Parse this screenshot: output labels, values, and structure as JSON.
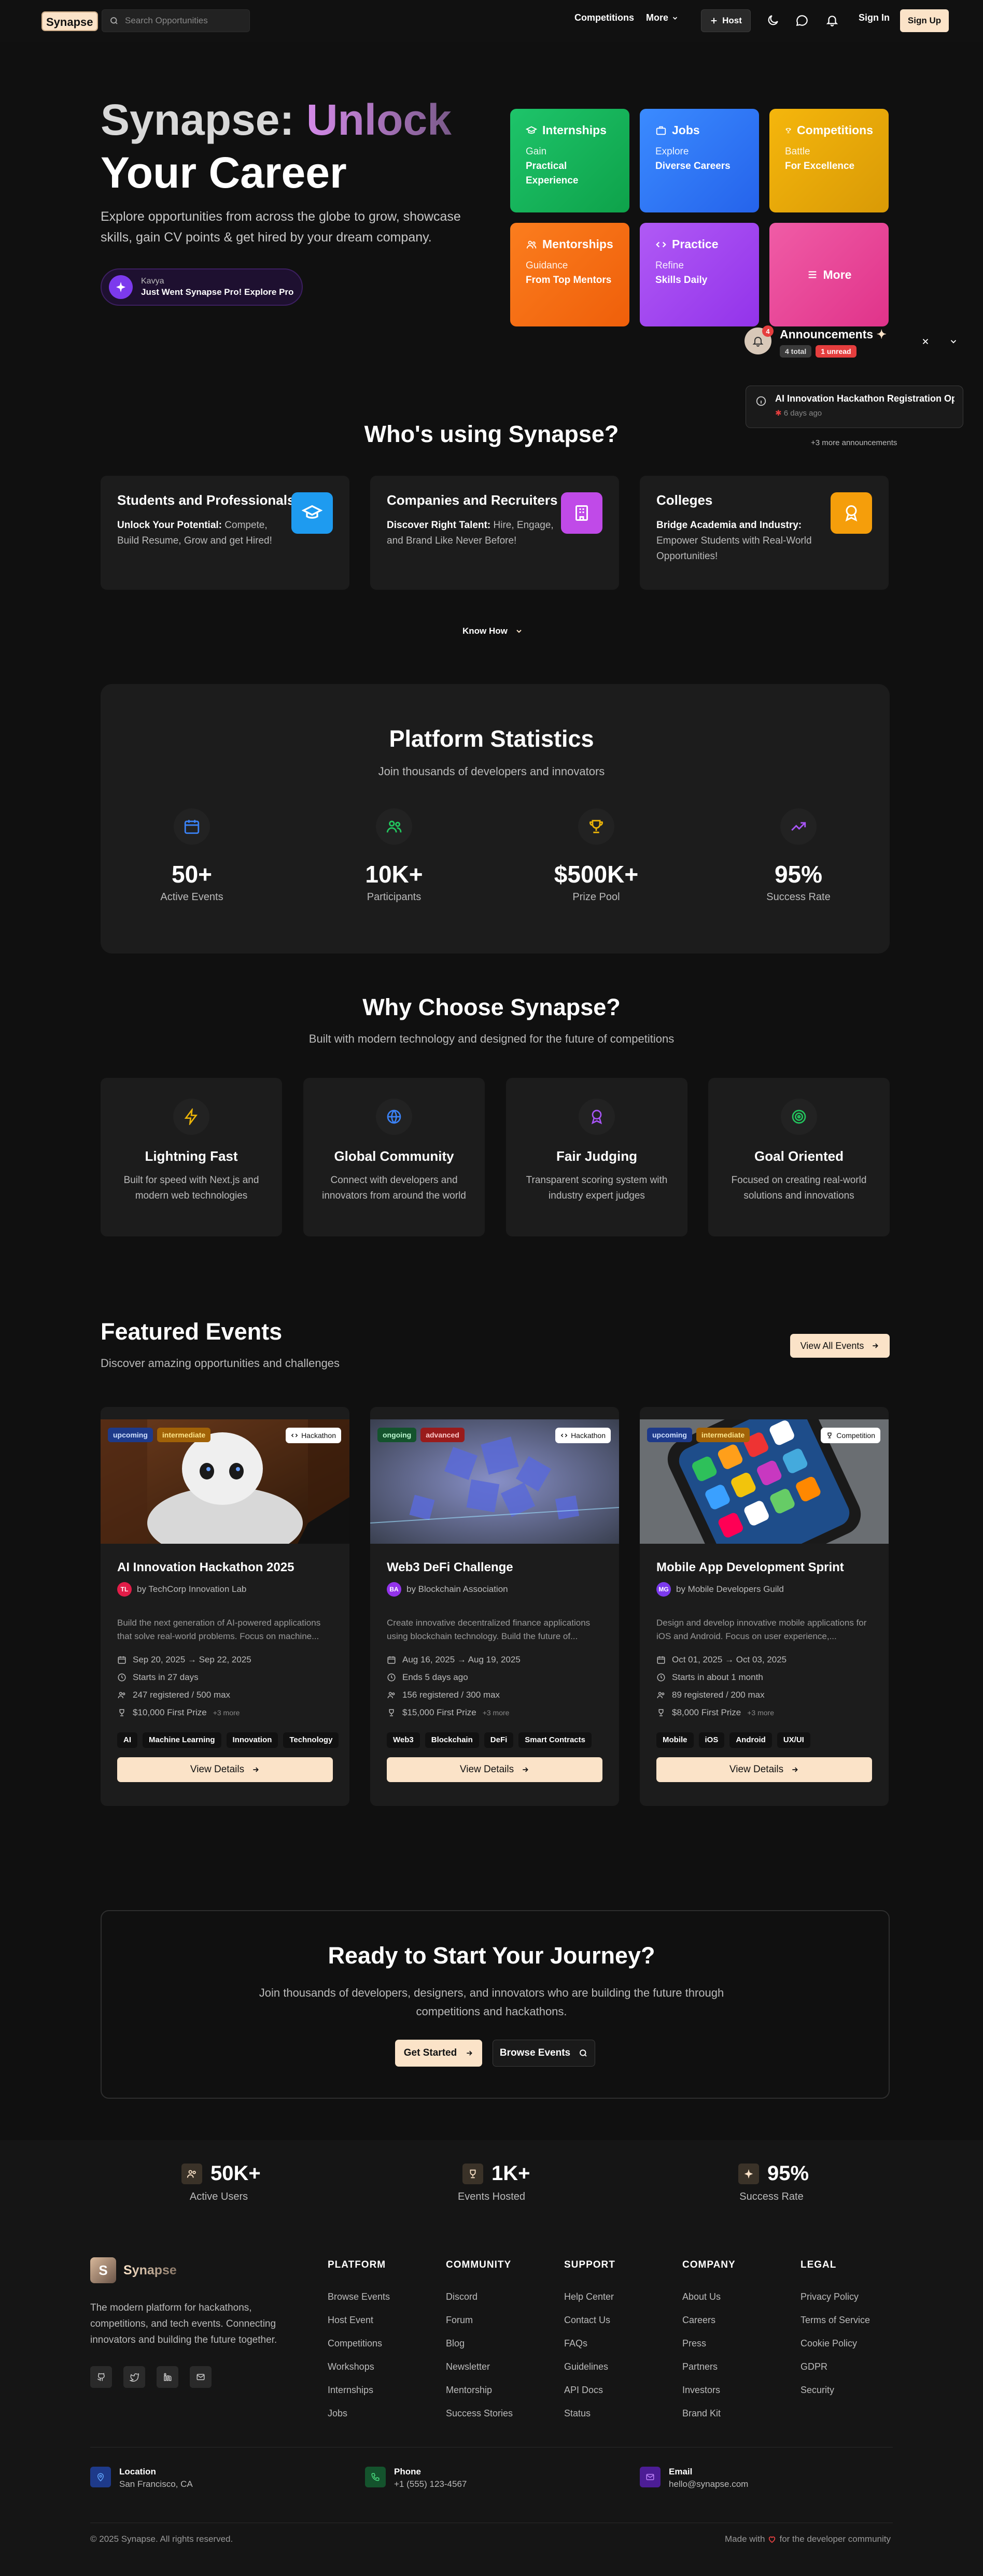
{
  "nav": {
    "logo": "Synapse",
    "search_placeholder": "Search Opportunities",
    "competitions": "Competitions",
    "more": "More",
    "host": "Host",
    "sign_in": "Sign In",
    "sign_up": "Sign Up"
  },
  "hero": {
    "title_part1": "Synapse: ",
    "title_part2": "Unlock",
    "title_line2": "Your Career",
    "subtitle": "Explore opportunities from across the globe to grow, showcase skills, gain CV points & get hired by your dream company.",
    "pill_name": "Kavya",
    "pill_text": "Just Went Synapse Pro! Explore Pro",
    "tiles": [
      {
        "title": "Internships",
        "line1": "Gain",
        "line2": "Practical Experience",
        "icon": "graduation-icon",
        "color": "#16b455"
      },
      {
        "title": "Jobs",
        "line1": "Explore",
        "line2": "Diverse Careers",
        "icon": "briefcase-icon",
        "color": "#2f7ef5"
      },
      {
        "title": "Competitions",
        "line1": "Battle",
        "line2": "For Excellence",
        "icon": "trophy-icon",
        "color": "#e8ab08"
      },
      {
        "title": "Mentorships",
        "line1": "Guidance",
        "line2": "From Top Mentors",
        "icon": "people-icon",
        "color": "#f77010"
      },
      {
        "title": "Practice",
        "line1": "Refine",
        "line2": "Skills Daily",
        "icon": "code-icon",
        "color": "#a445f2"
      },
      {
        "title": "More",
        "icon": "menu-icon",
        "color": "#ec4899"
      }
    ]
  },
  "announcements": {
    "title": "Announcements",
    "badge_count": "4",
    "total": "4 total",
    "unread": "1 unread",
    "item_title": "AI Innovation Hackathon Registration Op...",
    "item_time": "6 days ago",
    "more": "+3 more announcements"
  },
  "who": {
    "title": "Who's using Synapse?",
    "cards": [
      {
        "title": "Students and Professionals",
        "bold": "Unlock Your Potential:",
        "text": " Compete, Build Resume, Grow and get Hired!",
        "color": "#1e9bf0"
      },
      {
        "title": "Companies and Recruiters",
        "bold": "Discover Right Talent:",
        "text": " Hire, Engage, and Brand Like Never Before!",
        "color": "#c04ae8"
      },
      {
        "title": "Colleges",
        "bold": "Bridge Academia and Industry:",
        "text": " Empower Students with Real-World Opportunities!",
        "color": "#f59e0b"
      }
    ],
    "know_how": "Know How"
  },
  "stats": {
    "title": "Platform Statistics",
    "subtitle": "Join thousands of developers and innovators",
    "items": [
      {
        "value": "50+",
        "label": "Active Events",
        "icon": "calendar-icon",
        "color": "#3b82f6"
      },
      {
        "value": "10K+",
        "label": "Participants",
        "icon": "users-icon",
        "color": "#22c55e"
      },
      {
        "value": "$500K+",
        "label": "Prize Pool",
        "icon": "trophy-icon",
        "color": "#eab308"
      },
      {
        "value": "95%",
        "label": "Success Rate",
        "icon": "trending-up-icon",
        "color": "#a855f7"
      }
    ]
  },
  "why": {
    "title": "Why Choose Synapse?",
    "subtitle": "Built with modern technology and designed for the future of competitions",
    "items": [
      {
        "title": "Lightning Fast",
        "desc": "Built for speed with Next.js and modern web technologies",
        "icon": "zap-icon",
        "color": "#eab308"
      },
      {
        "title": "Global Community",
        "desc": "Connect with developers and innovators from around the world",
        "icon": "globe-icon",
        "color": "#3b82f6"
      },
      {
        "title": "Fair Judging",
        "desc": "Transparent scoring system with industry expert judges",
        "icon": "award-icon",
        "color": "#a855f7"
      },
      {
        "title": "Goal Oriented",
        "desc": "Focused on creating real-world solutions and innovations",
        "icon": "target-icon",
        "color": "#22c55e"
      }
    ]
  },
  "events": {
    "title": "Featured Events",
    "subtitle": "Discover amazing opportunities and challenges",
    "view_all": "View All Events",
    "view_details": "View Details",
    "items": [
      {
        "status": "upcoming",
        "level": "intermediate",
        "type": "Hackathon",
        "title": "AI Innovation Hackathon 2025",
        "org_initials": "TL",
        "org": "by TechCorp Innovation Lab",
        "org_color": "#e11d48",
        "desc": "Build the next generation of AI-powered applications that solve real-world problems. Focus on machine...",
        "dates": "Sep 20, 2025 → Sep 22, 2025",
        "when": "Starts in 27 days",
        "registered": "247 registered / 500 max",
        "prize": "$10,000 First Prize",
        "prize_more": "+3 more",
        "tags": [
          "AI",
          "Machine Learning",
          "Innovation",
          "Technology"
        ]
      },
      {
        "status": "ongoing",
        "level": "advanced",
        "type": "Hackathon",
        "title": "Web3 DeFi Challenge",
        "org_initials": "BA",
        "org": "by Blockchain Association",
        "org_color": "#9333ea",
        "desc": "Create innovative decentralized finance applications using blockchain technology. Build the future of...",
        "dates": "Aug 16, 2025 → Aug 19, 2025",
        "when": "Ends 5 days ago",
        "registered": "156 registered / 300 max",
        "prize": "$15,000 First Prize",
        "prize_more": "+3 more",
        "tags": [
          "Web3",
          "Blockchain",
          "DeFi",
          "Smart Contracts"
        ]
      },
      {
        "status": "upcoming",
        "level": "intermediate",
        "type": "Competition",
        "title": "Mobile App Development Sprint",
        "org_initials": "MG",
        "org": "by Mobile Developers Guild",
        "org_color": "#7c3aed",
        "desc": "Design and develop innovative mobile applications for iOS and Android. Focus on user experience,...",
        "dates": "Oct 01, 2025 → Oct 03, 2025",
        "when": "Starts in about 1 month",
        "registered": "89 registered / 200 max",
        "prize": "$8,000 First Prize",
        "prize_more": "+3 more",
        "tags": [
          "Mobile",
          "iOS",
          "Android",
          "UX/UI"
        ]
      }
    ]
  },
  "cta": {
    "title": "Ready to Start Your Journey?",
    "subtitle": "Join thousands of developers, designers, and innovators who are building the future through competitions and hackathons.",
    "get_started": "Get Started",
    "browse": "Browse Events"
  },
  "footer": {
    "stats": [
      {
        "value": "50K+",
        "label": "Active Users"
      },
      {
        "value": "1K+",
        "label": "Events Hosted"
      },
      {
        "value": "95%",
        "label": "Success Rate"
      }
    ],
    "brand": "Synapse",
    "brand_letter": "S",
    "about": "The modern platform for hackathons, competitions, and tech events. Connecting innovators and building the future together.",
    "columns": [
      {
        "title": "PLATFORM",
        "items": [
          "Browse Events",
          "Host Event",
          "Competitions",
          "Workshops",
          "Internships",
          "Jobs"
        ]
      },
      {
        "title": "COMMUNITY",
        "items": [
          "Discord",
          "Forum",
          "Blog",
          "Newsletter",
          "Mentorship",
          "Success Stories"
        ]
      },
      {
        "title": "SUPPORT",
        "items": [
          "Help Center",
          "Contact Us",
          "FAQs",
          "Guidelines",
          "API Docs",
          "Status"
        ]
      },
      {
        "title": "COMPANY",
        "items": [
          "About Us",
          "Careers",
          "Press",
          "Partners",
          "Investors",
          "Brand Kit"
        ]
      },
      {
        "title": "LEGAL",
        "items": [
          "Privacy Policy",
          "Terms of Service",
          "Cookie Policy",
          "GDPR",
          "Security"
        ]
      }
    ],
    "contacts": [
      {
        "label": "Location",
        "value": "San Francisco, CA",
        "color": "#1e3a8a"
      },
      {
        "label": "Phone",
        "value": "+1 (555) 123-4567",
        "color": "#14532d"
      },
      {
        "label": "Email",
        "value": "hello@synapse.com",
        "color": "#4c1d95"
      }
    ],
    "copyright": "© 2025 Synapse. All rights reserved.",
    "made_with": "Made with",
    "made_for": "for the developer community"
  }
}
